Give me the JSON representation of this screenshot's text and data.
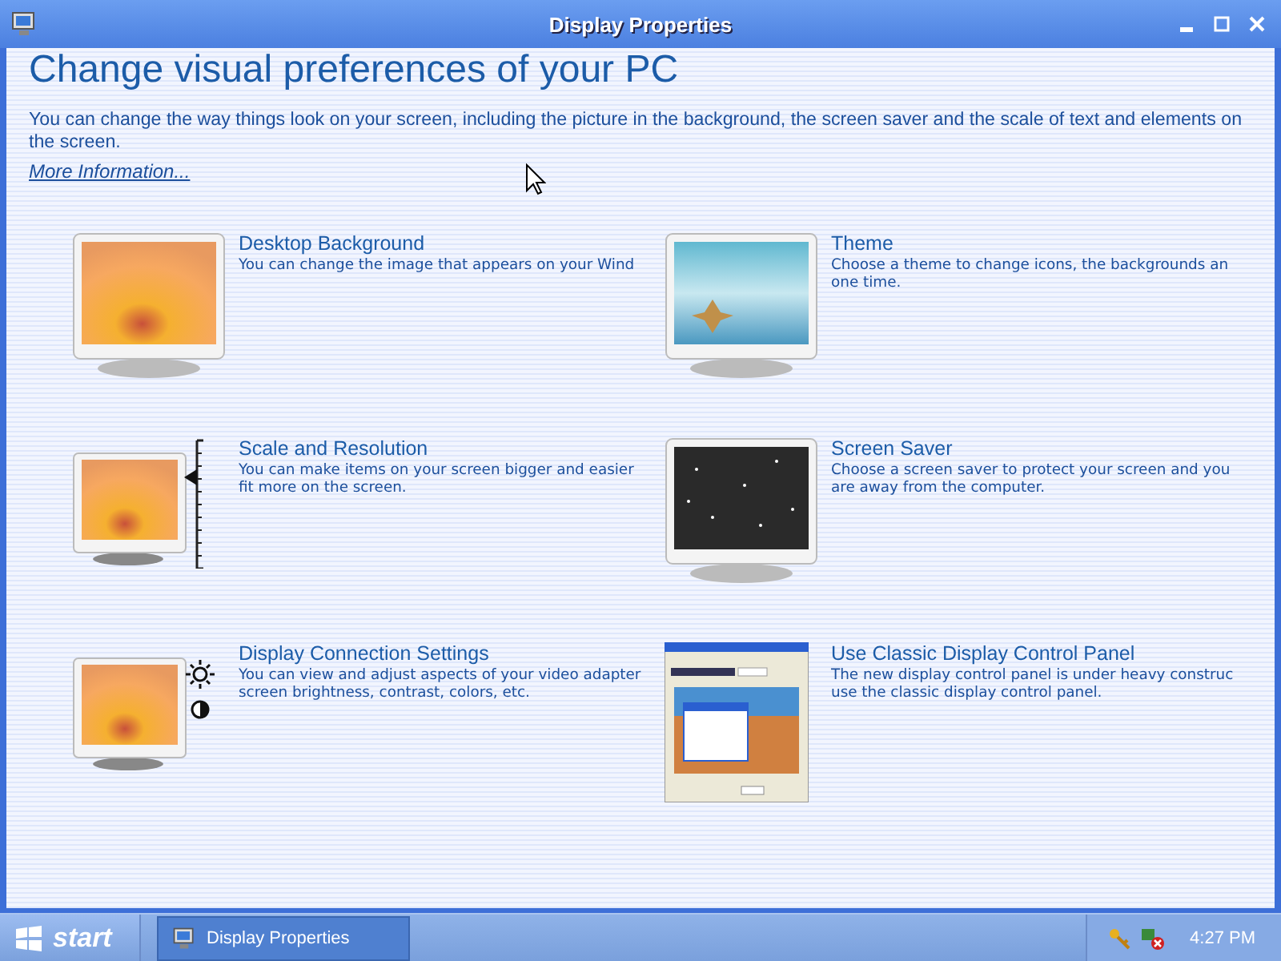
{
  "window": {
    "title": "Display Properties"
  },
  "heading": "Change visual preferences of your PC",
  "intro": "You can change the way things look on your screen, including the picture in the background, the screen saver and the scale of text and elements on the screen.",
  "more_link": "More Information...",
  "options": [
    {
      "kind": "background",
      "title": "Desktop Background",
      "lines": [
        "You can change the image that appears on your Wind"
      ]
    },
    {
      "kind": "theme",
      "title": "Theme",
      "lines": [
        "Choose a theme to change icons, the backgrounds an",
        "one time."
      ]
    },
    {
      "kind": "scale",
      "title": "Scale and Resolution",
      "lines": [
        "You can make items on your screen bigger and easier",
        "fit more on the screen."
      ]
    },
    {
      "kind": "screensaver",
      "title": "Screen Saver",
      "lines": [
        "Choose a screen saver to protect your screen and you",
        "are away from the computer."
      ]
    },
    {
      "kind": "connection",
      "title": "Display Connection Settings",
      "lines": [
        "You can view and adjust aspects of your video adapter",
        "screen brightness, contrast, colors, etc."
      ]
    },
    {
      "kind": "classic",
      "title": "Use Classic Display Control Panel",
      "lines": [
        "The new display control panel is under heavy construc",
        "use the classic display control panel."
      ]
    }
  ],
  "taskbar": {
    "start": "start",
    "tasks": [
      {
        "label": "Display Properties",
        "selected": true
      }
    ],
    "clock": "4:27 PM"
  }
}
